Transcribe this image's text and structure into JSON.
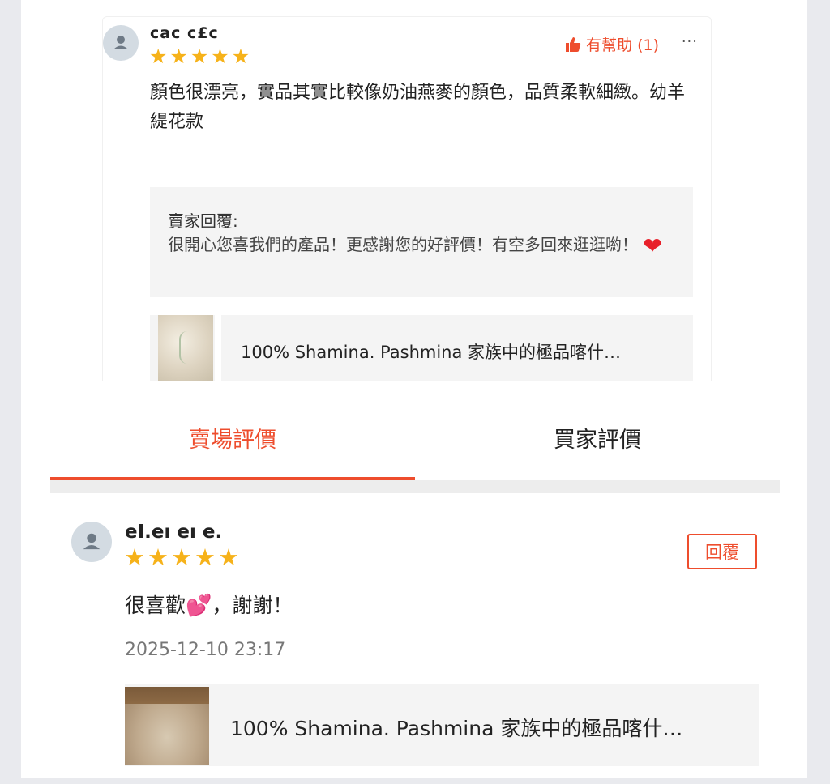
{
  "colors": {
    "accent": "#ee4d2d",
    "star": "#f6b21a",
    "avatar_bg": "#d3dbe2"
  },
  "top_review": {
    "username": "cac  c£c",
    "rating": 5,
    "stars": "★★★★★",
    "helpful_label": "有幫助 (1)",
    "more_icon": "···",
    "text": "顏色很漂亮，實品其實比較像奶油燕麥的顏色，品質柔軟細緻。幼羊緹花款",
    "seller_reply": {
      "title": "賣家回覆:",
      "text": "很開心您喜我們的產品！更感謝您的好評價！有空多回來逛逛喲！",
      "emoji": "❤"
    },
    "product": {
      "title": "100% Shamina. Pashmina 家族中的極品喀什…"
    }
  },
  "tabs": [
    {
      "label": "賣場評價",
      "active": true
    },
    {
      "label": "買家評價",
      "active": false
    }
  ],
  "review": {
    "username": "eI.eı eı e.",
    "rating": 5,
    "stars": "★★★★★",
    "reply_button": "回覆",
    "text_before": "很喜歡",
    "emoji": "💕",
    "text_after": "，謝謝！",
    "timestamp": "2025-12-10 23:17",
    "product": {
      "title": "100% Shamina. Pashmina 家族中的極品喀什…"
    }
  }
}
